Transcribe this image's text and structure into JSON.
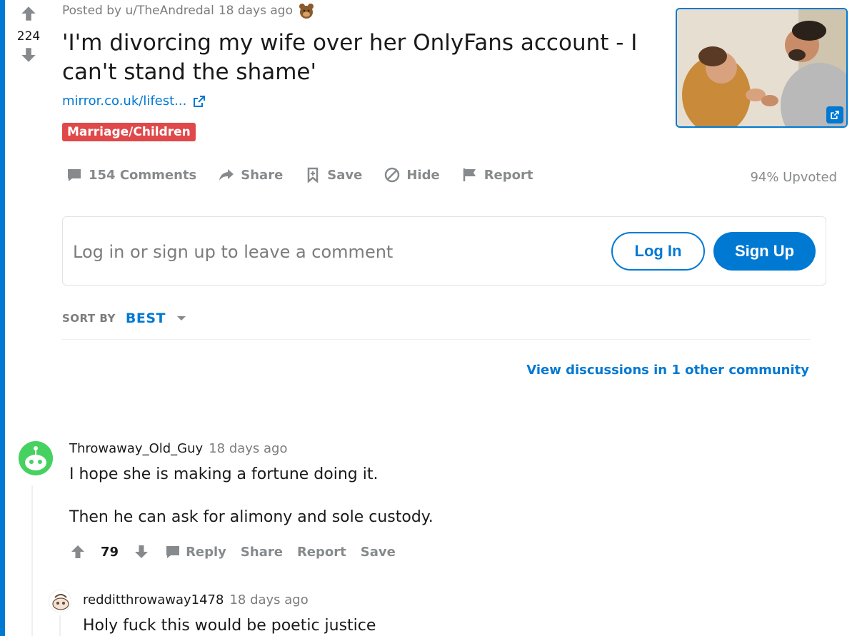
{
  "post": {
    "score": "224",
    "posted_by": "Posted by u/TheAndredal",
    "time": "18 days ago",
    "title": "'I'm divorcing my wife over her OnlyFans account - I can't stand the shame'",
    "link_text": "mirror.co.uk/lifest...",
    "flair": "Marriage/Children",
    "upvoted": "94% Upvoted"
  },
  "actions": {
    "comments": "154 Comments",
    "share": "Share",
    "save": "Save",
    "hide": "Hide",
    "report": "Report"
  },
  "comment_box": {
    "placeholder": "Log in or sign up to leave a comment",
    "login": "Log In",
    "signup": "Sign Up"
  },
  "sort": {
    "label": "SORT BY",
    "value": "BEST"
  },
  "other_discussions": "View discussions in 1 other community",
  "comments": [
    {
      "author": "Throwaway_Old_Guy",
      "time": "18 days ago",
      "lines": [
        "I hope she is making a fortune doing it.",
        "Then he can ask for alimony and sole custody."
      ],
      "score": "79",
      "reply": "Reply",
      "share": "Share",
      "report": "Report",
      "save": "Save"
    },
    {
      "author": "redditthrowaway1478",
      "time": "18 days ago",
      "lines": [
        "Holy fuck this would be poetic justice"
      ]
    }
  ],
  "colors": {
    "accent": "#0079d3",
    "flair": "#e0484a",
    "muted": "#878a8c"
  }
}
